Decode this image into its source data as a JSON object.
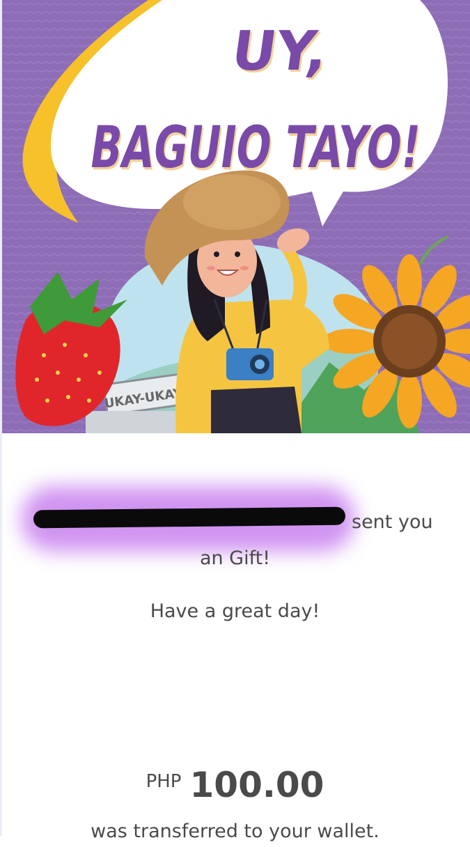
{
  "banner": {
    "headline_line1": "UY,",
    "headline_line2": "BAGUIO TAYO!",
    "sign_text": "UKAY-UKAY",
    "background_color": "#8c6bb5",
    "headline_color": "#7a4aa8",
    "bubble_color": "#ffffff",
    "accent_color": "#f7c02a"
  },
  "notification": {
    "sender_suffix": "sent you",
    "gift_line": "an Gift!",
    "greeting": "Have a great day!",
    "currency": "PHP",
    "amount": "100.00",
    "wallet_line": "was transferred to your wallet."
  },
  "colors": {
    "text": "#4a4a4a",
    "redaction_glow": "#b048e8",
    "redaction_bar": "#0a0a0a"
  }
}
